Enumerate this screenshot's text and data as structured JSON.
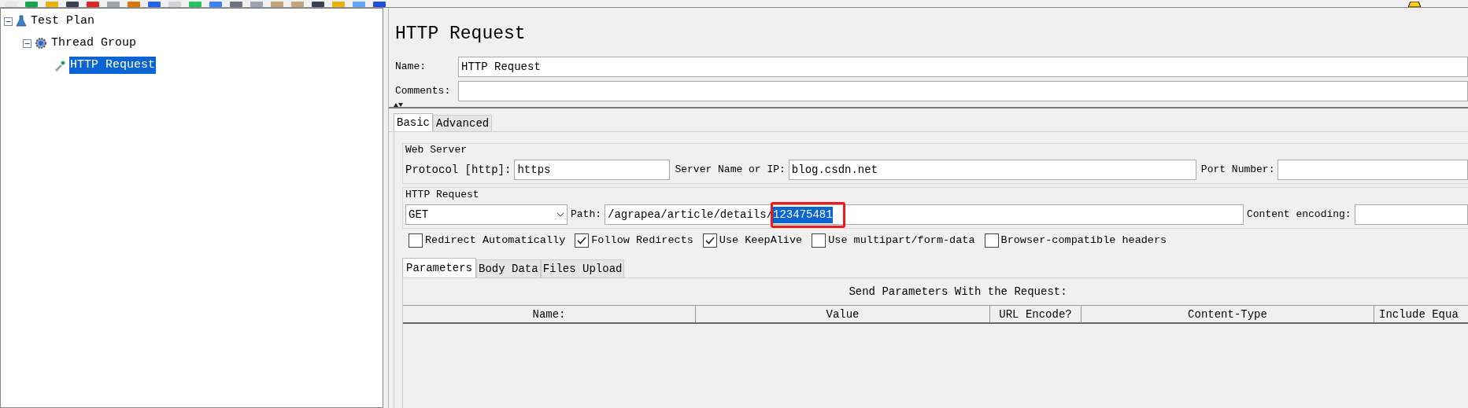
{
  "tree": [
    {
      "label": "Test Plan",
      "kind": "plan",
      "expanded": true,
      "selected": false,
      "children": [
        {
          "label": "Thread Group",
          "kind": "group",
          "expanded": true,
          "selected": false,
          "children": [
            {
              "label": "HTTP Request",
              "kind": "sampler",
              "selected": true
            }
          ]
        }
      ]
    }
  ],
  "panel": {
    "title": "HTTP Request",
    "name": {
      "label": "Name:",
      "value": "HTTP Request"
    },
    "comments": {
      "label": "Comments:"
    }
  },
  "tabs": [
    {
      "label": "Basic",
      "selected": true
    },
    {
      "label": "Advanced",
      "selected": false
    }
  ],
  "web_server": {
    "title": "Web Server",
    "protocol": {
      "label": "Protocol [http]:",
      "value": "https"
    },
    "server": {
      "label": "Server Name or IP:",
      "value": "blog.csdn.net"
    },
    "port": {
      "label": "Port Number:"
    }
  },
  "http_request": {
    "title": "HTTP Request",
    "method": "GET",
    "path": {
      "label": "Path:",
      "value": "/agrapea/article/details/",
      "selected_text": "123475481"
    },
    "encoding": {
      "label": "Content encoding:"
    }
  },
  "options": [
    {
      "label": "Redirect Automatically",
      "checked": false
    },
    {
      "label": "Follow Redirects",
      "checked": true
    },
    {
      "label": "Use KeepAlive",
      "checked": true
    },
    {
      "label": "Use multipart/form-data",
      "checked": false
    },
    {
      "label": "Browser-compatible headers",
      "checked": false
    }
  ],
  "sub_tabs": [
    {
      "label": "Parameters",
      "selected": true
    },
    {
      "label": "Body Data",
      "selected": false
    },
    {
      "label": "Files Upload",
      "selected": false
    }
  ],
  "parameters": {
    "caption": "Send Parameters With the Request:",
    "columns": [
      "Name:",
      "Value",
      "URL Encode?",
      "Content-Type",
      "Include Equa"
    ]
  }
}
